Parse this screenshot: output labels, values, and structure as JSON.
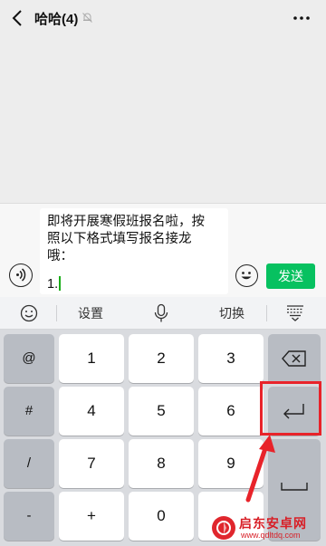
{
  "header": {
    "title": "哈哈(4)",
    "back_icon": "chevron-left-icon",
    "mute_icon": "bell-off-icon",
    "more_icon": "more-dots-icon"
  },
  "input": {
    "text_lines": [
      "即将开展寒假班报名啦，按",
      "照以下格式填写报名接龙",
      "哦："
    ],
    "entry_line": "1.",
    "send_label": "发送",
    "voice_icon": "voice-icon",
    "emoji_icon": "emoji-icon"
  },
  "ime_toolbar": {
    "settings_label": "设置",
    "switch_label": "切换",
    "emoji_icon": "smiley-icon",
    "mic_icon": "microphone-icon",
    "hide_icon": "keyboard-hide-icon"
  },
  "keyboard": {
    "rows": [
      {
        "side": "@",
        "keys": [
          "1",
          "2",
          "3"
        ],
        "action_icon": "backspace-icon"
      },
      {
        "side": "#",
        "keys": [
          "4",
          "5",
          "6"
        ],
        "action_icon": "enter-icon"
      },
      {
        "side": "/",
        "keys": [
          "7",
          "8",
          "9"
        ],
        "action_icon": "space-icon"
      },
      {
        "side": "-",
        "keys": [
          "+",
          "0",
          "."
        ]
      }
    ]
  },
  "annotation": {
    "color": "#e8232a",
    "target": "enter-key"
  },
  "watermark": {
    "name": "启东安卓网",
    "url": "www.qdltdq.com"
  },
  "colors": {
    "send_button": "#07c160",
    "background": "#ededed",
    "caret": "#1aad19"
  }
}
